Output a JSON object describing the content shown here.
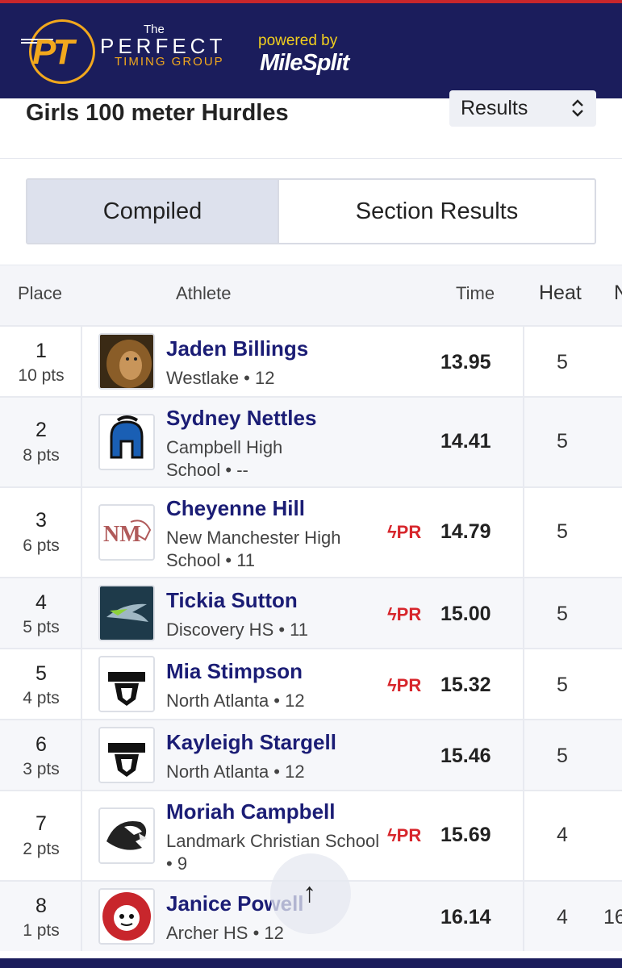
{
  "header": {
    "brand_the": "The",
    "brand_perfect": "PERFECT",
    "brand_timing": "TIMING GROUP",
    "brand_logo_letters": "PT",
    "powered_by": "powered by",
    "milesplit": "MileSplit",
    "brand_color": "#1b1d5c",
    "accent_color": "#f2a81d"
  },
  "event": {
    "title": "Girls 100 meter Hurdles",
    "view_select": "Results"
  },
  "tabs": [
    {
      "label": "Compiled",
      "active": true
    },
    {
      "label": "Section Results",
      "active": false
    }
  ],
  "columns": {
    "place": "Place",
    "athlete": "Athlete",
    "time": "Time",
    "heat": "Heat",
    "extra": "N"
  },
  "rows": [
    {
      "place": "1",
      "pts": "10 pts",
      "name": "Jaden Billings",
      "sub": "Westlake • 12",
      "pr": "",
      "time": "13.95",
      "heat": "5",
      "avatar": "lion-icon"
    },
    {
      "place": "2",
      "pts": "8 pts",
      "name": "Sydney Nettles",
      "sub": "Campbell High School • --",
      "pr": "",
      "time": "14.41",
      "heat": "5",
      "avatar": "spartan-icon"
    },
    {
      "place": "3",
      "pts": "6 pts",
      "name": "Cheyenne Hill",
      "sub": "New Manchester High School • 11",
      "pr": "PR",
      "time": "14.79",
      "heat": "5",
      "avatar": "nm-panther-icon"
    },
    {
      "place": "4",
      "pts": "5 pts",
      "name": "Tickia Sutton",
      "sub": "Discovery HS • 11",
      "pr": "PR",
      "time": "15.00",
      "heat": "5",
      "avatar": "discovery-icon"
    },
    {
      "place": "5",
      "pts": "4 pts",
      "name": "Mia Stimpson",
      "sub": "North Atlanta • 12",
      "pr": "PR",
      "time": "15.32",
      "heat": "5",
      "avatar": "warriors-icon"
    },
    {
      "place": "6",
      "pts": "3 pts",
      "name": "Kayleigh Stargell",
      "sub": "North Atlanta • 12",
      "pr": "",
      "time": "15.46",
      "heat": "5",
      "avatar": "warriors-icon"
    },
    {
      "place": "7",
      "pts": "2 pts",
      "name": "Moriah Campbell",
      "sub": "Landmark Christian School • 9",
      "pr": "PR",
      "time": "15.69",
      "heat": "4",
      "avatar": "eagle-icon"
    },
    {
      "place": "8",
      "pts": "1 pts",
      "name": "Janice Powell",
      "sub": "Archer HS • 12",
      "pr": "",
      "time": "16.14",
      "heat": "4",
      "extra": "16",
      "avatar": "archer-tigers-icon"
    }
  ],
  "pr_color": "#d7262c",
  "name_color": "#1b1d75",
  "scroll_top_icon": "arrow-up-icon"
}
